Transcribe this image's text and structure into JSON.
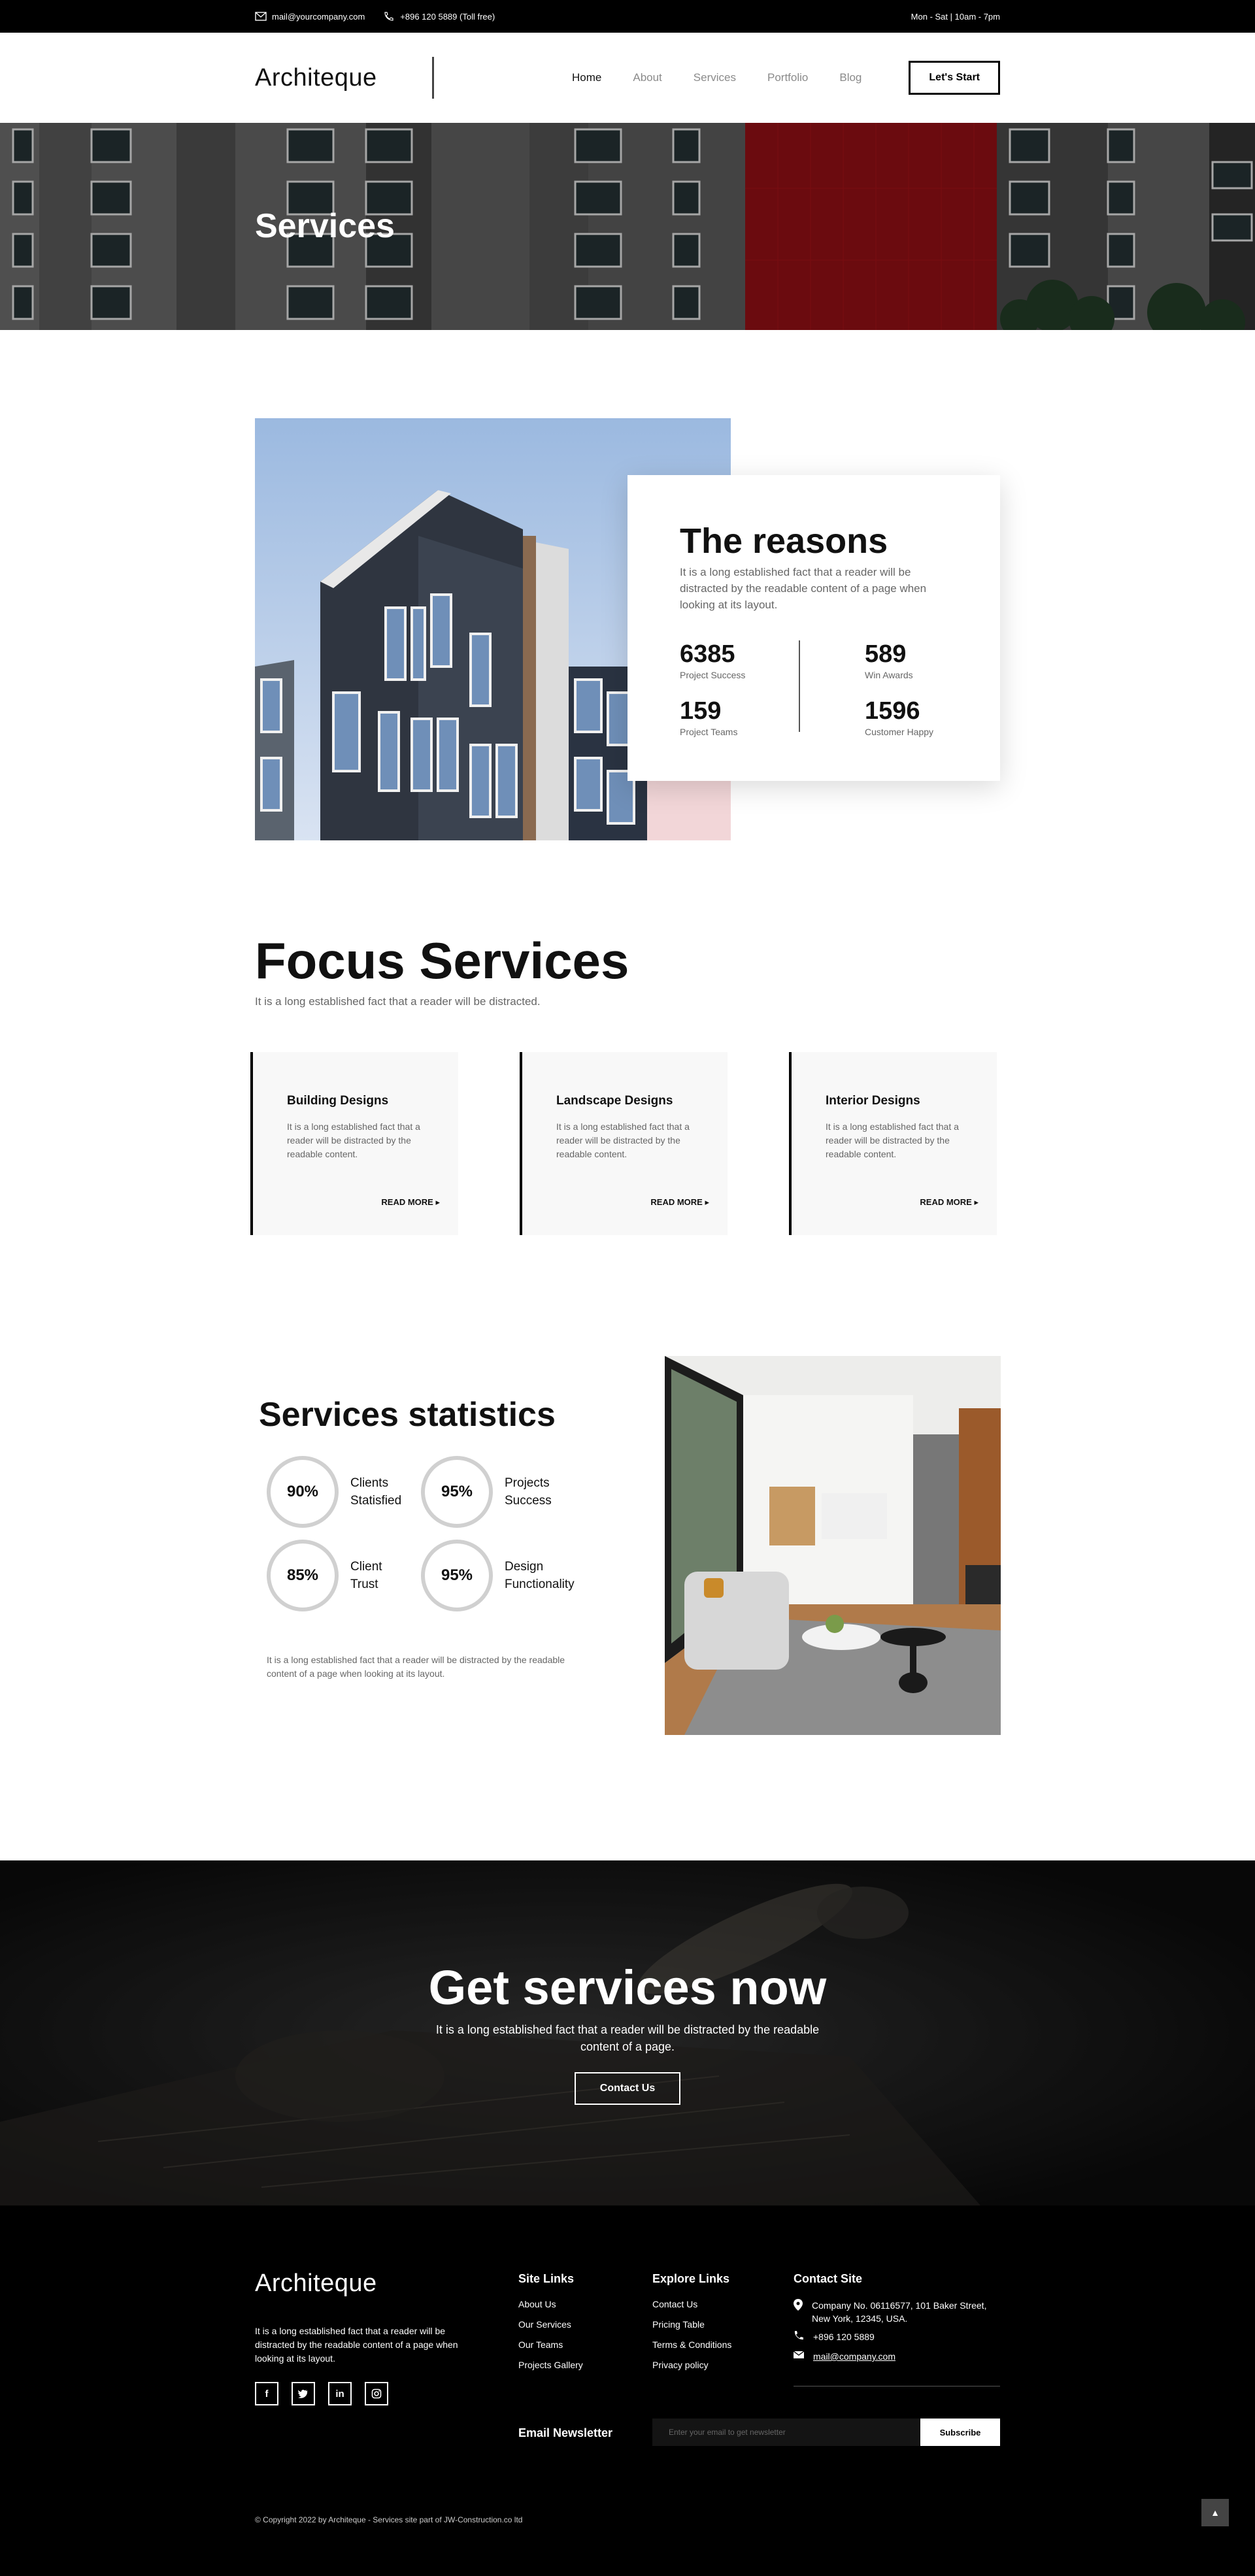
{
  "topbar": {
    "email": "mail@yourcompany.com",
    "phone": "+896 120 5889 (Toll free)",
    "hours": "Mon - Sat | 10am - 7pm"
  },
  "header": {
    "brand": "Architeque",
    "nav": [
      "Home",
      "About",
      "Services",
      "Portfolio",
      "Blog"
    ],
    "cta": "Let's Start"
  },
  "hero": {
    "title": "Services"
  },
  "reasons": {
    "title": "The reasons",
    "text": "It is a long established fact that a reader will be distracted by the readable content of a page when looking at its layout.",
    "stats": [
      {
        "num": "6385",
        "label": "Project Success"
      },
      {
        "num": "589",
        "label": "Win Awards"
      },
      {
        "num": "159",
        "label": "Project Teams"
      },
      {
        "num": "1596",
        "label": "Customer Happy"
      }
    ]
  },
  "focus": {
    "title": "Focus Services",
    "subtitle": "It is a long established fact that a reader will be distracted.",
    "cards": [
      {
        "title": "Building Designs",
        "text": "It is a long established fact that a reader will be distracted by the readable content.",
        "more": "READ MORE ▸"
      },
      {
        "title": "Landscape Designs",
        "text": "It is a long established fact that a reader will be distracted by the readable content.",
        "more": "READ MORE ▸"
      },
      {
        "title": "Interior Designs",
        "text": "It is a long established fact that a reader will be distracted by the readable content.",
        "more": "READ MORE ▸"
      }
    ]
  },
  "statistics": {
    "title": "Services statistics",
    "items": [
      {
        "value": "90%",
        "label1": "Clients",
        "label2": "Statisfied"
      },
      {
        "value": "95%",
        "label1": "Projects",
        "label2": "Success"
      },
      {
        "value": "85%",
        "label1": "Client",
        "label2": "Trust"
      },
      {
        "value": "95%",
        "label1": "Design",
        "label2": "Functionality"
      }
    ],
    "note": "It is a long established fact that a reader will be distracted by the readable content of a page when looking at its layout."
  },
  "cta": {
    "title": "Get services now",
    "text": "It is a long established fact that a reader will be distracted by the readable content of a page.",
    "button": "Contact Us"
  },
  "footer": {
    "brand": "Architeque",
    "about": "It is a long established fact that a reader will be distracted by the readable content of a page when looking at its layout.",
    "socials": [
      "f",
      "t",
      "in",
      "ig"
    ],
    "site_links": {
      "title": "Site Links",
      "items": [
        "About Us",
        "Our Services",
        "Our Teams",
        "Projects Gallery"
      ]
    },
    "explore_links": {
      "title": "Explore Links",
      "items": [
        "Contact Us",
        "Pricing Table",
        "Terms & Conditions",
        "Privacy policy"
      ]
    },
    "contact": {
      "title": "Contact Site",
      "address": "Company No. 06116577, 101 Baker Street, New York, 12345, USA.",
      "phone": "+896 120 5889",
      "email": "mail@company.com"
    },
    "newsletter": {
      "label": "Email Newsletter",
      "placeholder": "Enter your email to get newsletter",
      "button": "Subscribe"
    },
    "copyright": "© Copyright 2022 by Architeque - Services site part of JW-Construction.co ltd",
    "totop": "▲"
  }
}
